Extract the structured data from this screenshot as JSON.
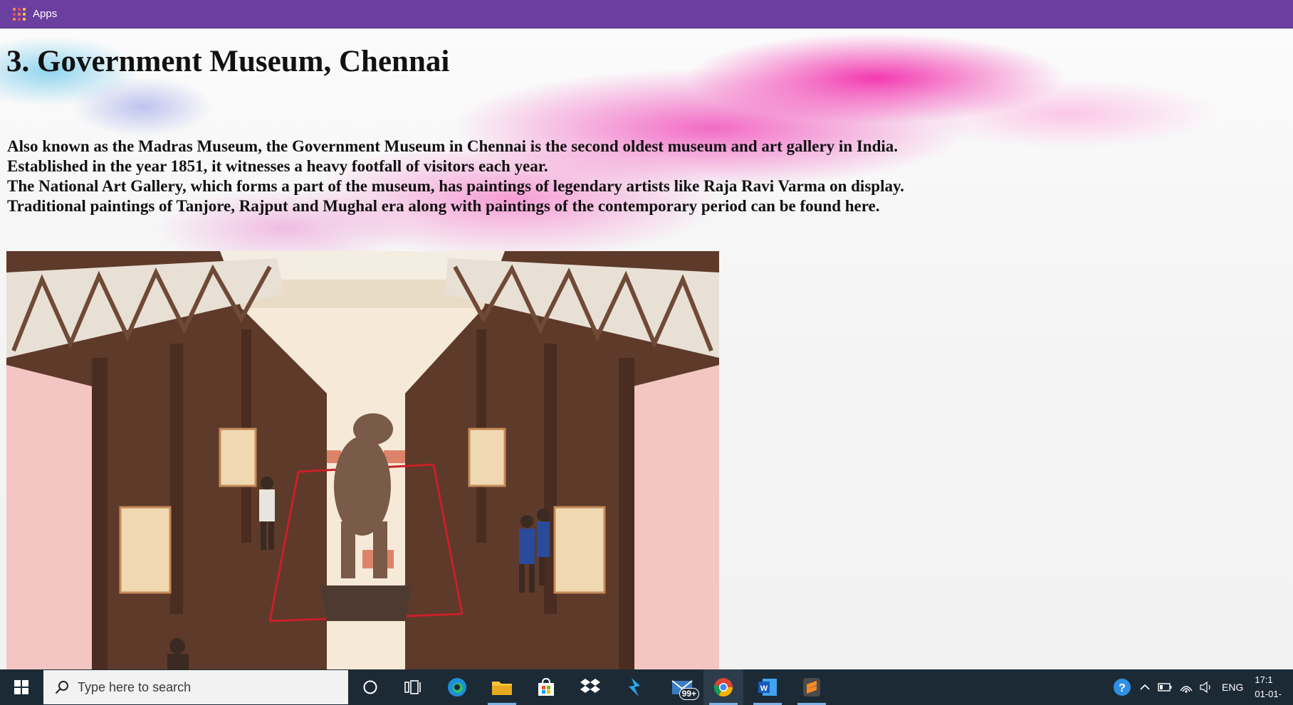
{
  "bookmarks_bar": {
    "apps_label": "Apps"
  },
  "page": {
    "title": "3. Government Museum, Chennai",
    "description_lines": [
      "Also known as the Madras Museum, the Government Museum in Chennai is the second oldest museum and art gallery in India.",
      "Established in the year 1851, it witnesses a heavy footfall of visitors each year.",
      "The National Art Gallery, which forms a part of the museum, has paintings of legendary artists like Raja Ravi Varma on display.",
      "Traditional paintings of Tanjore, Rajput and Mughal era along with paintings of the contemporary period can be found here."
    ]
  },
  "taskbar": {
    "search_placeholder": "Type here to search",
    "mail_badge": "99+",
    "language": "ENG",
    "time": "17:1",
    "date": "01-01-"
  },
  "colors": {
    "bookmarks_bar": "#6b3fa0",
    "taskbar": "#1c2a36",
    "accent_pink": "#f228aa"
  }
}
